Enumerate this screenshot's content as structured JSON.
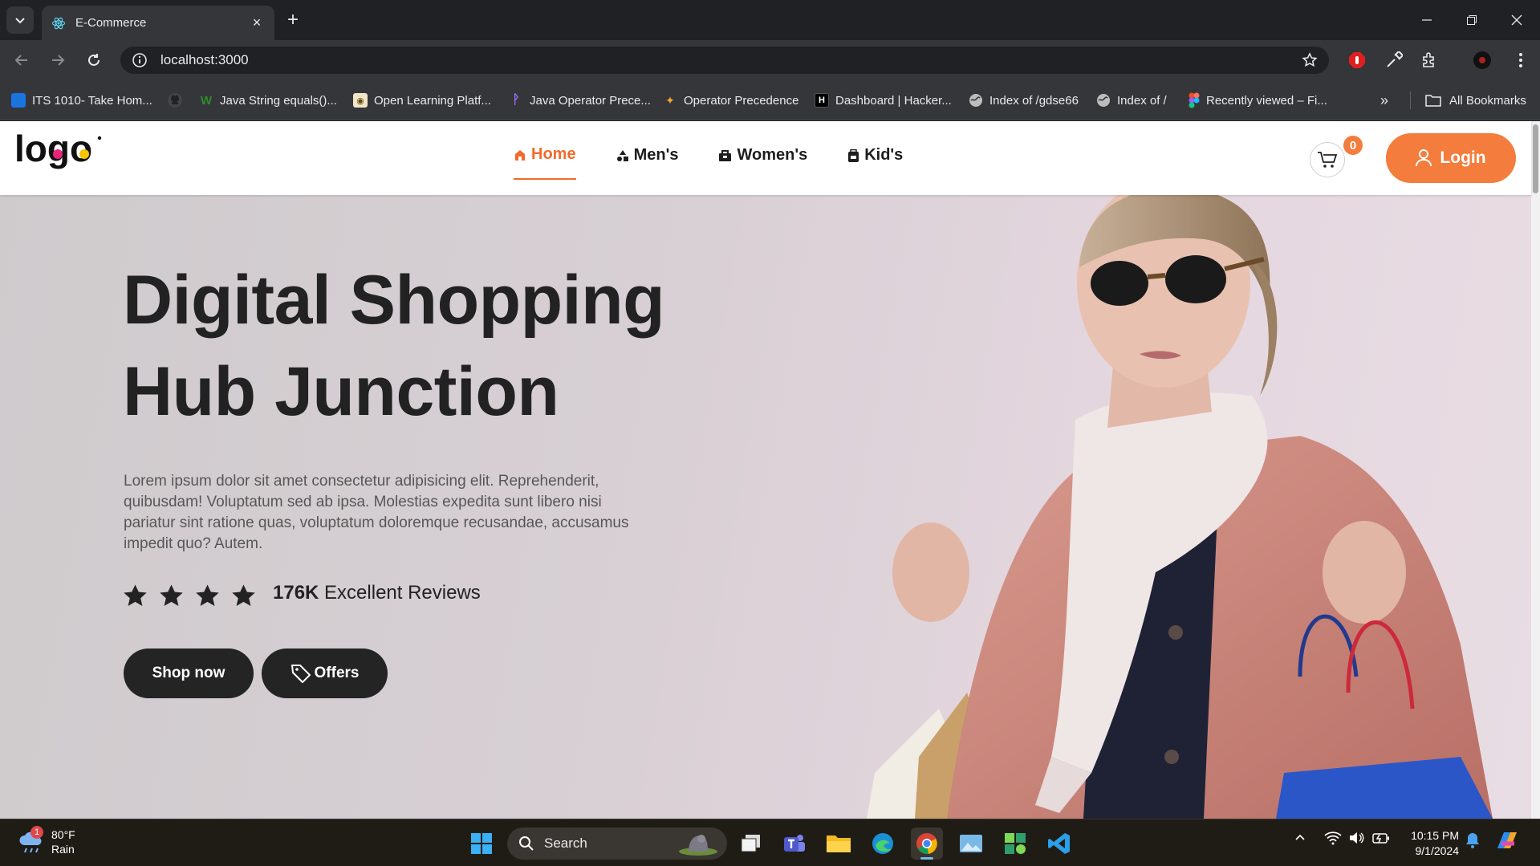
{
  "browser": {
    "tab_title": "E-Commerce",
    "url": "localhost:3000",
    "bookmarks": [
      {
        "label": "ITS 1010- Take Hom...",
        "icon": "classroom-icon",
        "color": "#1a73e8"
      },
      {
        "label": "",
        "icon": "github-icon",
        "color": "#ffffff"
      },
      {
        "label": "Java String equals()...",
        "icon": "w3resource-icon",
        "color": "#2e8b2e"
      },
      {
        "label": "Open Learning Platf...",
        "icon": "open-learning-icon",
        "color": "#f0e6c8"
      },
      {
        "label": "Java Operator Prece...",
        "icon": "site-icon",
        "color": "#7b4dff"
      },
      {
        "label": "Operator Precedence",
        "icon": "site-icon",
        "color": "#f4a533"
      },
      {
        "label": "Dashboard | Hacker...",
        "icon": "hackerrank-icon",
        "color": "#000000"
      },
      {
        "label": "Index of /gdse66",
        "icon": "globe-icon",
        "color": "#bdbdbd"
      },
      {
        "label": "Index of /",
        "icon": "globe-icon",
        "color": "#bdbdbd"
      },
      {
        "label": "Recently viewed – Fi...",
        "icon": "figma-icon",
        "color": "#f24e1e"
      }
    ],
    "all_bookmarks": "All Bookmarks",
    "overflow": "»"
  },
  "site": {
    "logo_text": "logo",
    "nav": [
      {
        "label": "Home",
        "icon": "home-icon",
        "active": true
      },
      {
        "label": "Men's",
        "icon": "shapes-icon",
        "active": false
      },
      {
        "label": "Women's",
        "icon": "bag-icon",
        "active": false
      },
      {
        "label": "Kid's",
        "icon": "backpack-icon",
        "active": false
      }
    ],
    "cart_count": "0",
    "login_label": "Login"
  },
  "hero": {
    "title_line1": "Digital Shopping",
    "title_line2": "Hub Junction",
    "description": "Lorem ipsum dolor sit amet consectetur adipisicing elit. Reprehenderit, quibusdam! Voluptatum sed ab ipsa. Molestias expedita sunt libero nisi pariatur sint ratione quas, voluptatum doloremque recusandae, accusamus impedit quo? Autem.",
    "rating_stars": 4,
    "reviews_count": "176K",
    "reviews_label": "Excellent Reviews",
    "shop_now": "Shop now",
    "offers": "Offers"
  },
  "taskbar": {
    "weather_temp": "80°F",
    "weather_desc": "Rain",
    "weather_badge": "1",
    "search_placeholder": "Search",
    "time": "10:15 PM",
    "date": "9/1/2024"
  },
  "colors": {
    "accent": "#f47c3c",
    "dark_button": "#242424",
    "logo_pink": "#e8247a",
    "logo_yellow": "#f5c400"
  }
}
